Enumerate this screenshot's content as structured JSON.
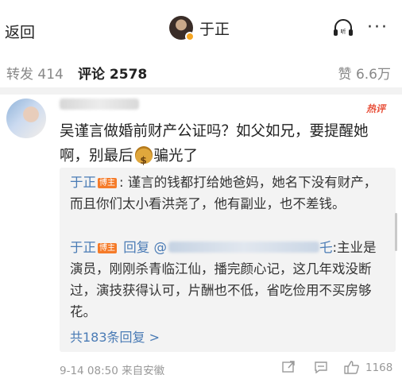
{
  "header": {
    "back_label": "返回",
    "title": "于正",
    "more_label": "···"
  },
  "tabs": {
    "repost": "转发 414",
    "comment": "评论 2578",
    "like": "赞 6.6万"
  },
  "comment": {
    "badge": "热评",
    "text_part1": "吴谨言做婚前财产公证吗？如父如兄，要提醒她啊，别最后",
    "text_part2": "骗光了"
  },
  "replies": [
    {
      "author": "于正",
      "author_badge": "博主",
      "text": ": 谨言的钱都打给她爸妈，她名下没有财产，而且你们太小看洪尧了，他有副业，也不差钱。"
    },
    {
      "author": "于正",
      "author_badge": "博主",
      "reply_prefix": " 回复 @",
      "mention_tail": "乇",
      "text": ":主业是演员，刚刚杀青临江仙，播完颜心记，这几年戏没断过，演技获得认可，片酬也不低，省吃俭用不买房够花。"
    }
  ],
  "more_replies": "共183条回复 >",
  "footer": {
    "meta": "9-14 08:50 来自安徽",
    "like_count": "1168"
  },
  "icons": [
    "headset-icon",
    "more-icon",
    "money-bag-icon",
    "forward-icon",
    "comment-icon",
    "like-icon"
  ],
  "colors": {
    "link_blue": "#4a7bb5",
    "hot_red": "#e8503a",
    "blogger_badge": "#f57b29"
  }
}
